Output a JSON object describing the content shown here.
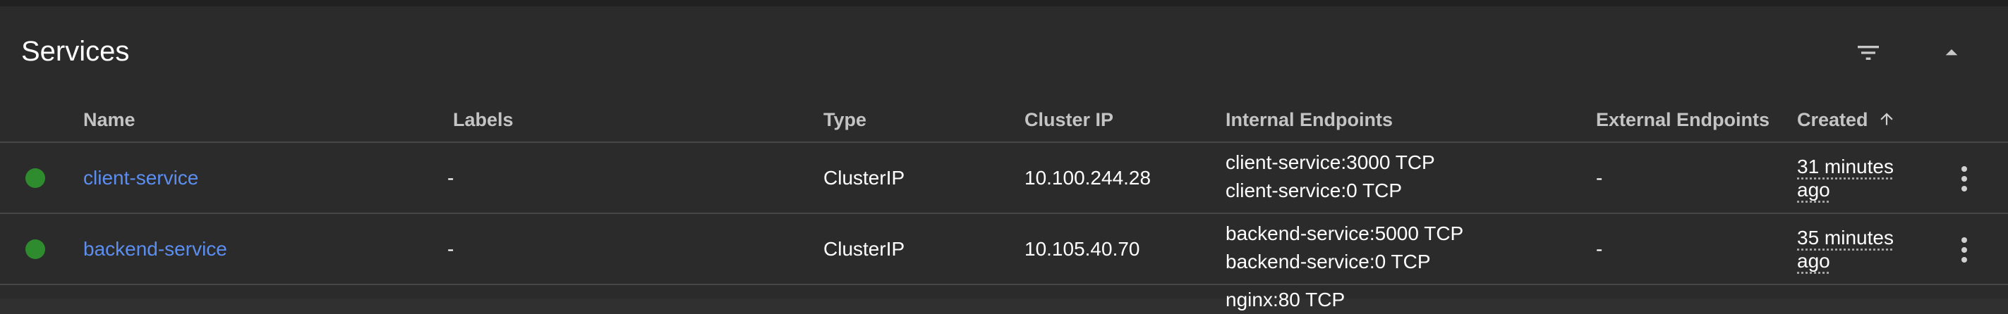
{
  "card": {
    "title": "Services",
    "icons": {
      "filter": "filter-icon",
      "collapse": "expand-less-icon"
    }
  },
  "columns": {
    "name": "Name",
    "labels": "Labels",
    "type": "Type",
    "cluster_ip": "Cluster IP",
    "internal_endpoints": "Internal Endpoints",
    "external_endpoints": "External Endpoints",
    "created": "Created",
    "created_sort_icon": "arrow-upward-icon"
  },
  "rows": [
    {
      "status": "ok",
      "name": "client-service",
      "labels": "-",
      "type": "ClusterIP",
      "cluster_ip": "10.100.244.28",
      "internal_endpoints": [
        "client-service:3000 TCP",
        "client-service:0 TCP"
      ],
      "external_endpoints": "-",
      "created_line1": "31 minutes",
      "created_line2": "ago"
    },
    {
      "status": "ok",
      "name": "backend-service",
      "labels": "-",
      "type": "ClusterIP",
      "cluster_ip": "10.105.40.70",
      "internal_endpoints": [
        "backend-service:5000 TCP",
        "backend-service:0 TCP"
      ],
      "external_endpoints": "-",
      "created_line1": "35 minutes",
      "created_line2": "ago"
    }
  ],
  "partial_row": {
    "internal_endpoint": "nginx:80 TCP"
  },
  "colors": {
    "status_ok": "#2e8b2e",
    "link": "#5c8ef0",
    "background": "#2b2b2b"
  }
}
